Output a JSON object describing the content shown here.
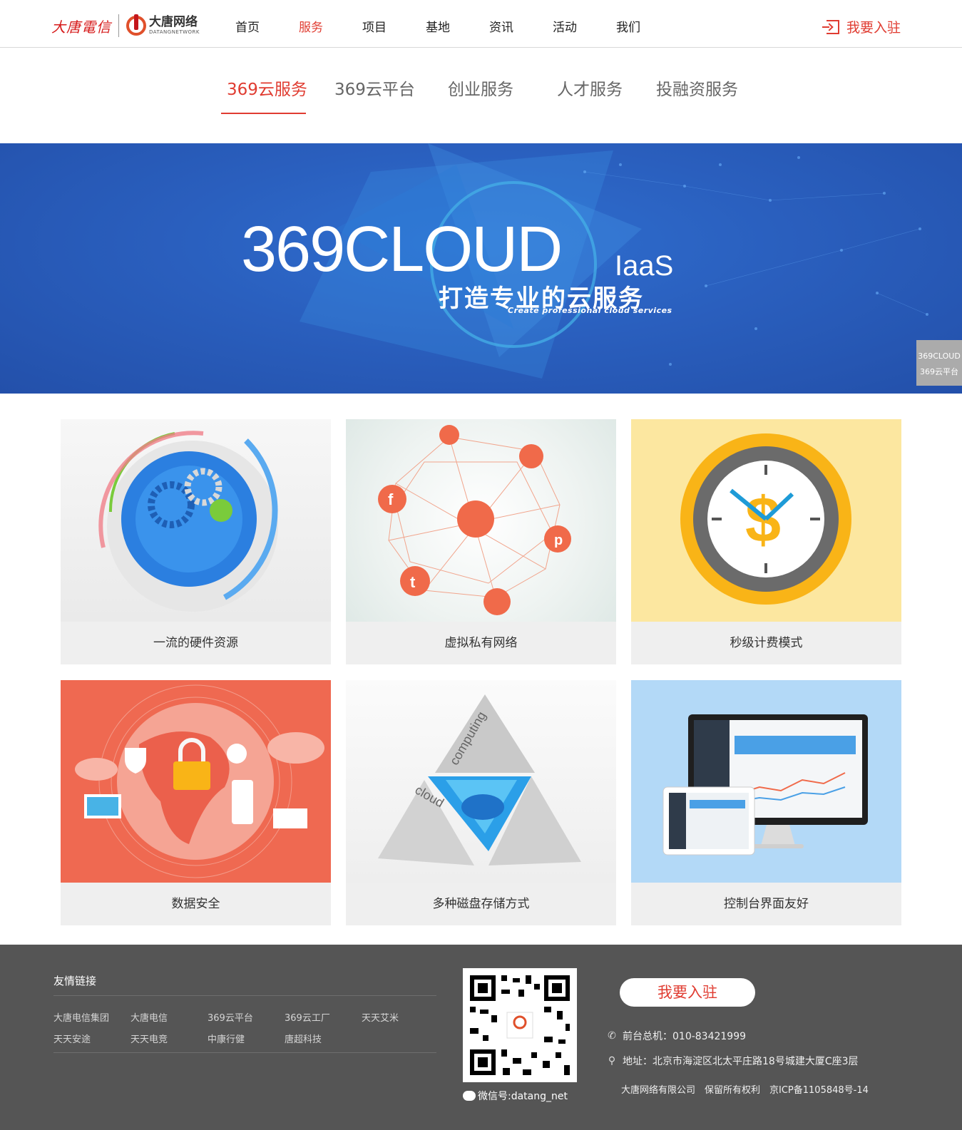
{
  "header": {
    "logo_datang_telecom": "大唐電信",
    "logo_network_cn": "大唐网络",
    "logo_network_en": "DATANGNETWORK",
    "nav": [
      {
        "label": "首页",
        "active": false
      },
      {
        "label": "服务",
        "active": true
      },
      {
        "label": "项目",
        "active": false
      },
      {
        "label": "基地",
        "active": false
      },
      {
        "label": "资讯",
        "active": false
      },
      {
        "label": "活动",
        "active": false
      },
      {
        "label": "我们",
        "active": false
      }
    ],
    "join_label": "我要入驻",
    "accent_color": "#e03c31"
  },
  "subtabs": [
    {
      "label": "369云服务",
      "active": true
    },
    {
      "label": "369云平台",
      "active": false
    },
    {
      "label": "创业服务",
      "active": false
    },
    {
      "label": "人才服务",
      "active": false
    },
    {
      "label": "投融资服务",
      "active": false
    }
  ],
  "banner": {
    "title": "369CLOUD",
    "suffix": "IaaS",
    "slogan_cn": "打造专业的云服务",
    "slogan_en": "Create professional cloud services",
    "side_tab_line1": "369CLOUD",
    "side_tab_line2": "369云平台"
  },
  "cards": [
    {
      "label": "一流的硬件资源",
      "icon": "gears-icon"
    },
    {
      "label": "虚拟私有网络",
      "icon": "network-icon"
    },
    {
      "label": "秒级计费模式",
      "icon": "clock-dollar-icon"
    },
    {
      "label": "数据安全",
      "icon": "security-globe-icon"
    },
    {
      "label": "多种磁盘存储方式",
      "icon": "cloud-computing-icon"
    },
    {
      "label": "控制台界面友好",
      "icon": "dashboard-screens-icon"
    }
  ],
  "footer": {
    "links_title": "友情链接",
    "links": [
      "大唐电信集团",
      "大唐电信",
      "369云平台",
      "369云工厂",
      "天天艾米",
      "天天安途",
      "天天电竞",
      "中康行健",
      "唐超科技"
    ],
    "wechat": "微信号:datang_net",
    "join_label": "我要入驻",
    "phone": "前台总机：010-83421999",
    "address": "地址：北京市海淀区北太平庄路18号城建大厦C座3层",
    "copyright": "大唐网络有限公司　保留所有权利　京ICP备1105848号-14"
  }
}
